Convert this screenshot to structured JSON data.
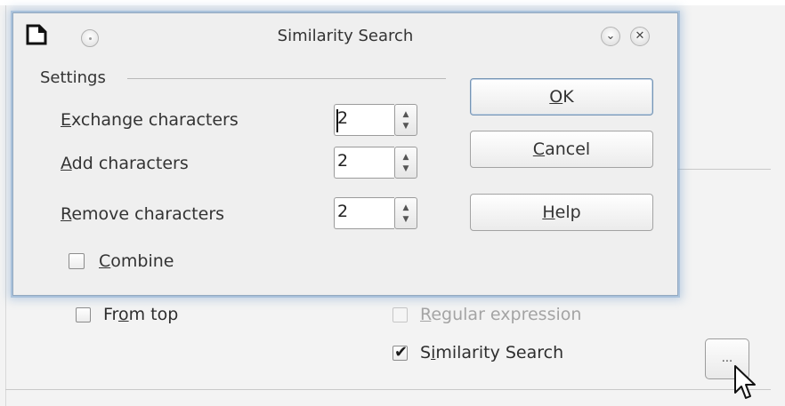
{
  "background": {
    "from_top": {
      "label_pre": "Fr",
      "label_ul": "o",
      "label_post": "m top",
      "checked": false
    },
    "regular_expression": {
      "label_ul": "R",
      "label_post": "egular expression",
      "enabled": false
    },
    "similarity_search": {
      "label_pre": "S",
      "label_ul": "i",
      "label_post": "milarity Search",
      "checked": true
    },
    "dots_button": "..."
  },
  "dialog": {
    "title": "Similarity Search",
    "group_label": "Settings",
    "fields": [
      {
        "label_ul": "E",
        "label_post": "xchange characters",
        "value": "2"
      },
      {
        "label_ul": "A",
        "label_post": "dd characters",
        "value": "2"
      },
      {
        "label_ul": "R",
        "label_post": "emove characters",
        "value": "2"
      }
    ],
    "combine": {
      "label_ul": "C",
      "label_post": "ombine",
      "checked": false
    },
    "buttons": {
      "ok": {
        "label_ul": "O",
        "label_post": "K"
      },
      "cancel": {
        "label_ul": "C",
        "label_post": "ancel"
      },
      "help": {
        "label_ul": "H",
        "label_post": "elp"
      }
    },
    "titlebar_buttons": {
      "minimize": "⌄",
      "close": "✕"
    }
  },
  "colors": {
    "focus_glow": "#8cafd2",
    "window_bg": "#efefef",
    "default_button_border": "#7594b4"
  }
}
